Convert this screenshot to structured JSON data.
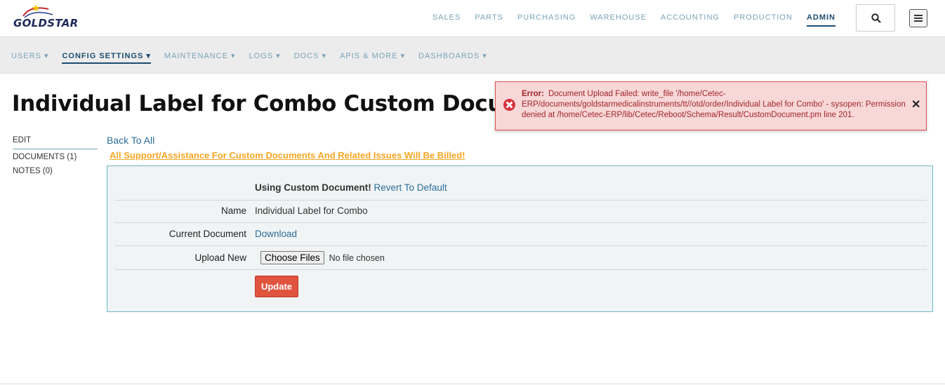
{
  "brand": {
    "logo_text": "GOLDSTAR"
  },
  "top_nav": [
    {
      "label": "SALES",
      "active": false
    },
    {
      "label": "PARTS",
      "active": false
    },
    {
      "label": "PURCHASING",
      "active": false
    },
    {
      "label": "WAREHOUSE",
      "active": false
    },
    {
      "label": "ACCOUNTING",
      "active": false
    },
    {
      "label": "PRODUCTION",
      "active": false
    },
    {
      "label": "ADMIN",
      "active": true
    }
  ],
  "sub_nav": [
    {
      "label": "USERS ▾",
      "active": false
    },
    {
      "label": "CONFIG SETTINGS ▾",
      "active": true
    },
    {
      "label": "MAINTENANCE ▾",
      "active": false
    },
    {
      "label": "LOGS ▾",
      "active": false
    },
    {
      "label": "DOCS ▾",
      "active": false
    },
    {
      "label": "APIS & MORE ▾",
      "active": false
    },
    {
      "label": "DASHBOARDS ▾",
      "active": false
    }
  ],
  "page": {
    "title": "Individual Label for Combo Custom Document"
  },
  "error": {
    "label": "Error:",
    "message": "Document Upload Failed: write_file '/home/Cetec-ERP/documents/goldstarmedicalinstruments/tt//otd/order/Individual Label for Combo' - sysopen: Permission denied at /home/Cetec-ERP/lib/Cetec/Reboot/Schema/Result/CustomDocument.pm line 201.",
    "close": "✕"
  },
  "side_nav": [
    {
      "label": "EDIT",
      "active": true
    },
    {
      "label": "DOCUMENTS (1)",
      "active": false
    },
    {
      "label": "NOTES (0)",
      "active": false
    }
  ],
  "content": {
    "back_link": "Back To All",
    "warning": "All Support/Assistance For Custom Documents And Related Issues Will Be Billed!",
    "custom_status": "Using Custom Document!",
    "revert_link": "Revert To Default",
    "name_label": "Name",
    "name_value": "Individual Label for Combo",
    "current_doc_label": "Current Document",
    "download_link": "Download",
    "upload_label": "Upload New",
    "choose_files": "Choose Files",
    "no_file": "No file chosen",
    "update_button": "Update"
  }
}
